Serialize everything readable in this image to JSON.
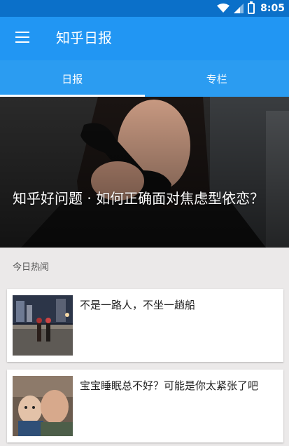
{
  "status_bar": {
    "time": "8:05",
    "battery_level": "8",
    "icons": [
      "wifi-icon",
      "signal-icon",
      "battery-icon"
    ]
  },
  "app_bar": {
    "title": "知乎日报",
    "menu_icon": "menu-icon"
  },
  "tabs": [
    {
      "label": "日报",
      "active": true
    },
    {
      "label": "专栏",
      "active": false
    }
  ],
  "hero": {
    "title": "知乎好问题 · 如何正确面对焦虑型依恋？"
  },
  "section": {
    "label": "今日热闻"
  },
  "stories": [
    {
      "title": "不是一路人，不坐一趟船"
    },
    {
      "title": "宝宝睡眠总不好？可能是你太紧张了吧"
    }
  ],
  "colors": {
    "status_bar": "#0b70c9",
    "app_bar": "#2196f3",
    "tabs": "#2b9cf1",
    "background": "#ebe9e9"
  }
}
